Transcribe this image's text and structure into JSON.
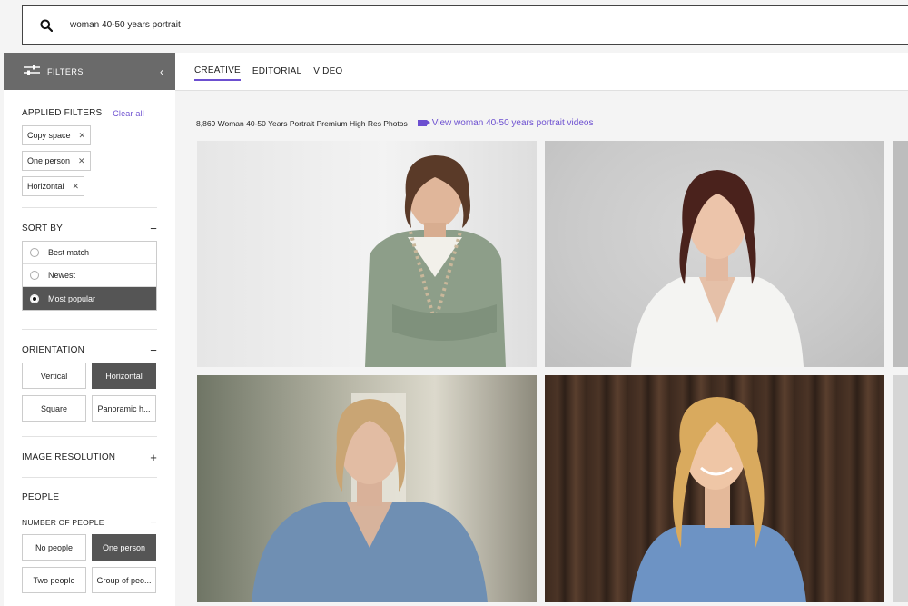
{
  "search": {
    "query": "woman 40-50 years portrait"
  },
  "sidebar": {
    "header_label": "FILTERS",
    "applied": {
      "title": "APPLIED FILTERS",
      "clear_label": "Clear all",
      "chips": [
        "Copy space",
        "One person",
        "Horizontal"
      ]
    },
    "sort": {
      "title": "SORT BY",
      "options": [
        "Best match",
        "Newest",
        "Most popular"
      ],
      "selected": "Most popular"
    },
    "orientation": {
      "title": "ORIENTATION",
      "options": [
        "Vertical",
        "Horizontal",
        "Square",
        "Panoramic h..."
      ],
      "selected": "Horizontal"
    },
    "resolution": {
      "title": "IMAGE RESOLUTION"
    },
    "people": {
      "title": "PEOPLE",
      "number_title": "NUMBER OF PEOPLE",
      "options": [
        "No people",
        "One person",
        "Two people",
        "Group of peo..."
      ],
      "selected": "One person"
    }
  },
  "main": {
    "tabs": [
      "CREATIVE",
      "EDITORIAL",
      "VIDEO"
    ],
    "active_tab": "CREATIVE",
    "results_text": "8,869 Woman 40-50 Years Portrait Premium High Res Photos",
    "video_link": "View woman 40-50 years portrait videos"
  },
  "colors": {
    "accent": "#6c4fd0",
    "selected_bg": "#555555",
    "header_bg": "#6a6a6a"
  },
  "icons": {
    "search": "search-icon",
    "filters": "sliders-icon",
    "collapse": "chevron-left-icon",
    "video": "video-camera-icon"
  }
}
